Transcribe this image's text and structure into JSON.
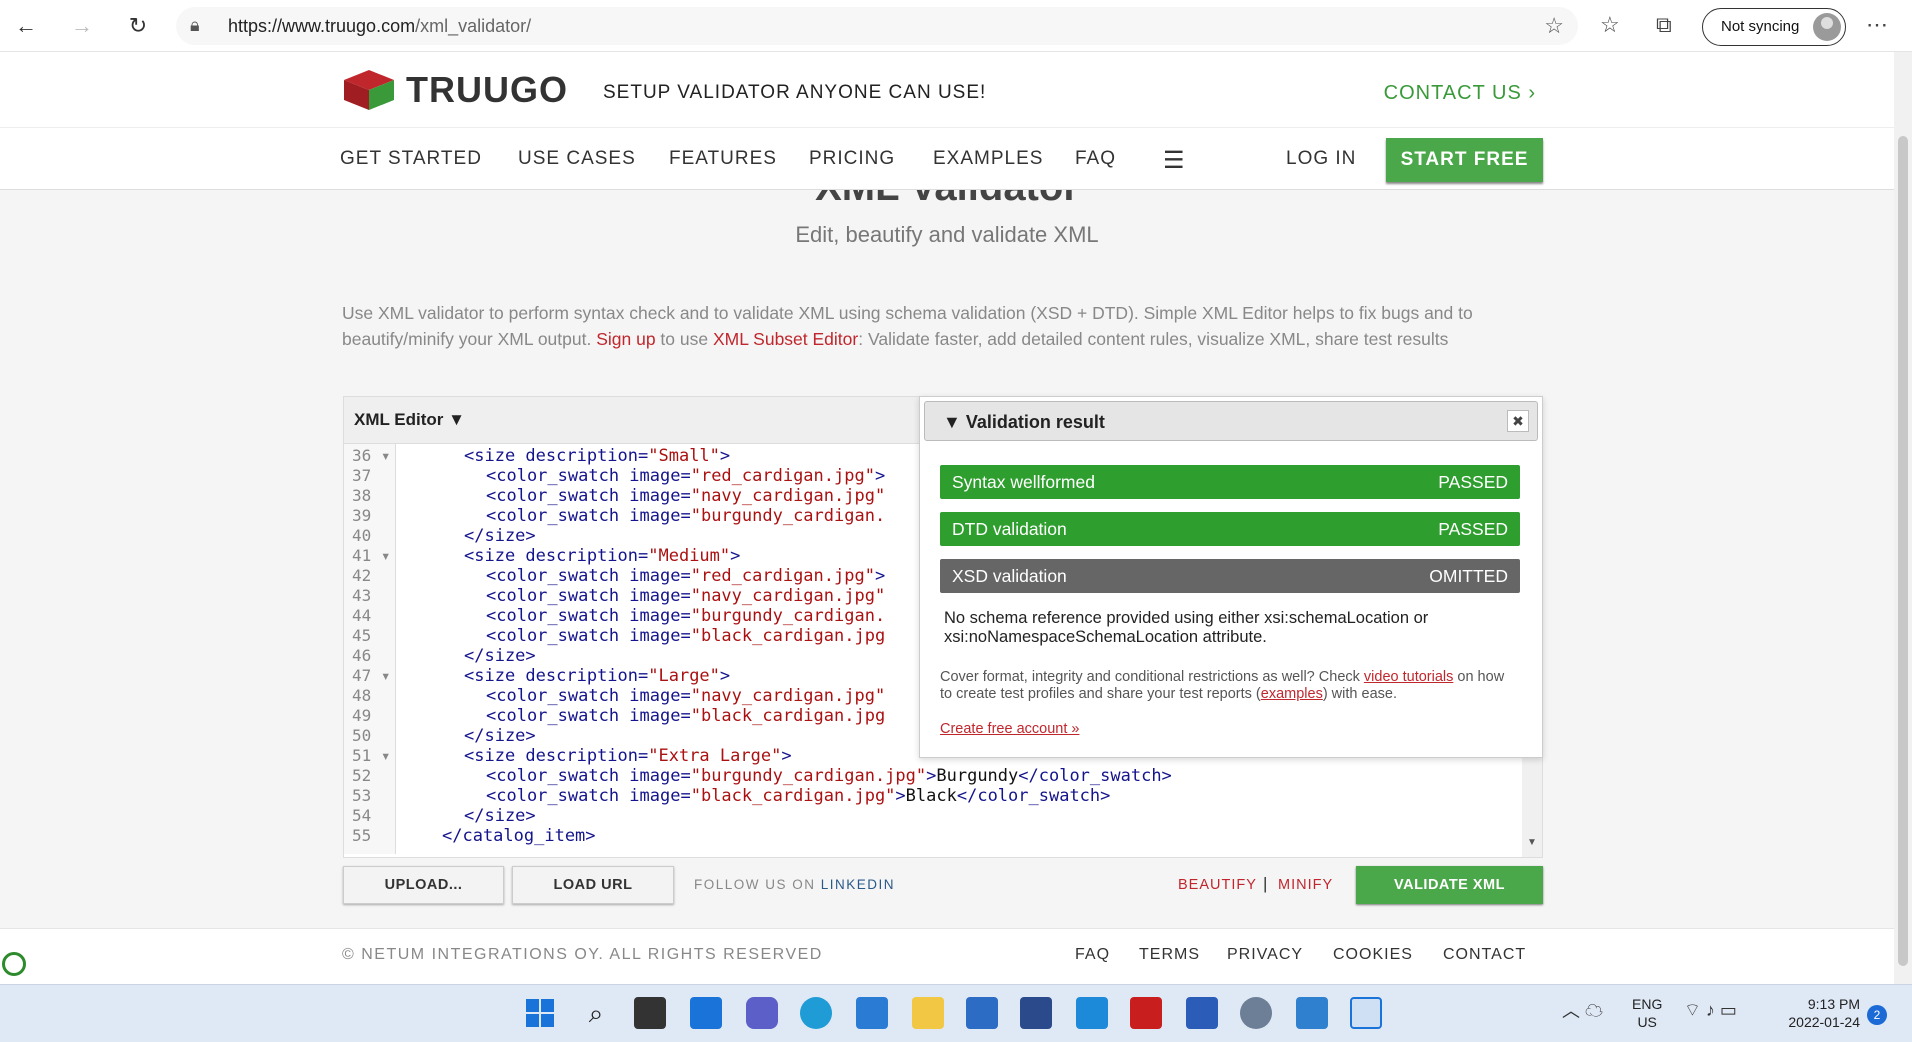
{
  "browser": {
    "url_host": "https://www.truugo.com",
    "url_path": "/xml_validator/",
    "sync_label": "Not syncing"
  },
  "header": {
    "brand": "TRUUGO",
    "tagline": "SETUP VALIDATOR ANYONE CAN USE!",
    "contact": "CONTACT US ›"
  },
  "nav": {
    "items": [
      "GET STARTED",
      "USE CASES",
      "FEATURES",
      "PRICING",
      "EXAMPLES",
      "FAQ"
    ],
    "login": "LOG IN",
    "start_free": "START FREE"
  },
  "page": {
    "title": "XML Validator",
    "subtitle": "Edit, beautify and validate XML",
    "intro_1": "Use XML validator to perform syntax check and to validate XML using schema validation (XSD + DTD). Simple XML Editor helps to fix bugs and to beautify/minify your XML output. ",
    "intro_signup": "Sign up",
    "intro_2": " to use ",
    "intro_subset": "XML Subset Editor",
    "intro_3": ": Validate faster, add detailed content rules, visualize XML, share test results"
  },
  "editor": {
    "title": "XML Editor ▼",
    "line_numbers": [
      "36 ▾",
      "37",
      "38",
      "39",
      "40",
      "41 ▾",
      "42",
      "43",
      "44",
      "45",
      "46",
      "47 ▾",
      "48",
      "49",
      "50",
      "51 ▾",
      "52",
      "53",
      "54",
      "55"
    ]
  },
  "validation": {
    "title": "Validation result",
    "rows": [
      {
        "label": "Syntax wellformed",
        "status": "PASSED"
      },
      {
        "label": "DTD validation",
        "status": "PASSED"
      },
      {
        "label": "XSD validation",
        "status": "OMITTED"
      }
    ],
    "message": "No schema reference provided using either xsi:schemaLocation or xsi:noNamespaceSchemaLocation attribute.",
    "cover_1": "Cover format, integrity and conditional restrictions as well? Check ",
    "cover_link": "video tutorials",
    "cover_2": " on how to create test profiles and share your test reports (",
    "cover_examples": "examples",
    "cover_3": ") with ease.",
    "create": "Create free account »"
  },
  "toolbar": {
    "upload": "UPLOAD...",
    "load_url": "LOAD URL",
    "follow": "FOLLOW US ON ",
    "linkedin": "LINKEDIN",
    "beautify": "BEAUTIFY",
    "separator": "|",
    "minify": "MINIFY",
    "validate": "VALIDATE XML"
  },
  "footer": {
    "copyright": "© NETUM INTEGRATIONS OY. ALL RIGHTS RESERVED",
    "links": [
      "FAQ",
      "TERMS",
      "PRIVACY",
      "COOKIES",
      "CONTACT"
    ]
  },
  "taskbar": {
    "lang_1": "ENG",
    "lang_2": "US",
    "time": "9:13 PM",
    "date": "2022-01-24",
    "notifications": "2"
  },
  "colors": {
    "brand_green": "#4aa84a",
    "brand_red": "#c0272d",
    "pass": "#2e9e2e",
    "omit": "#666666"
  }
}
